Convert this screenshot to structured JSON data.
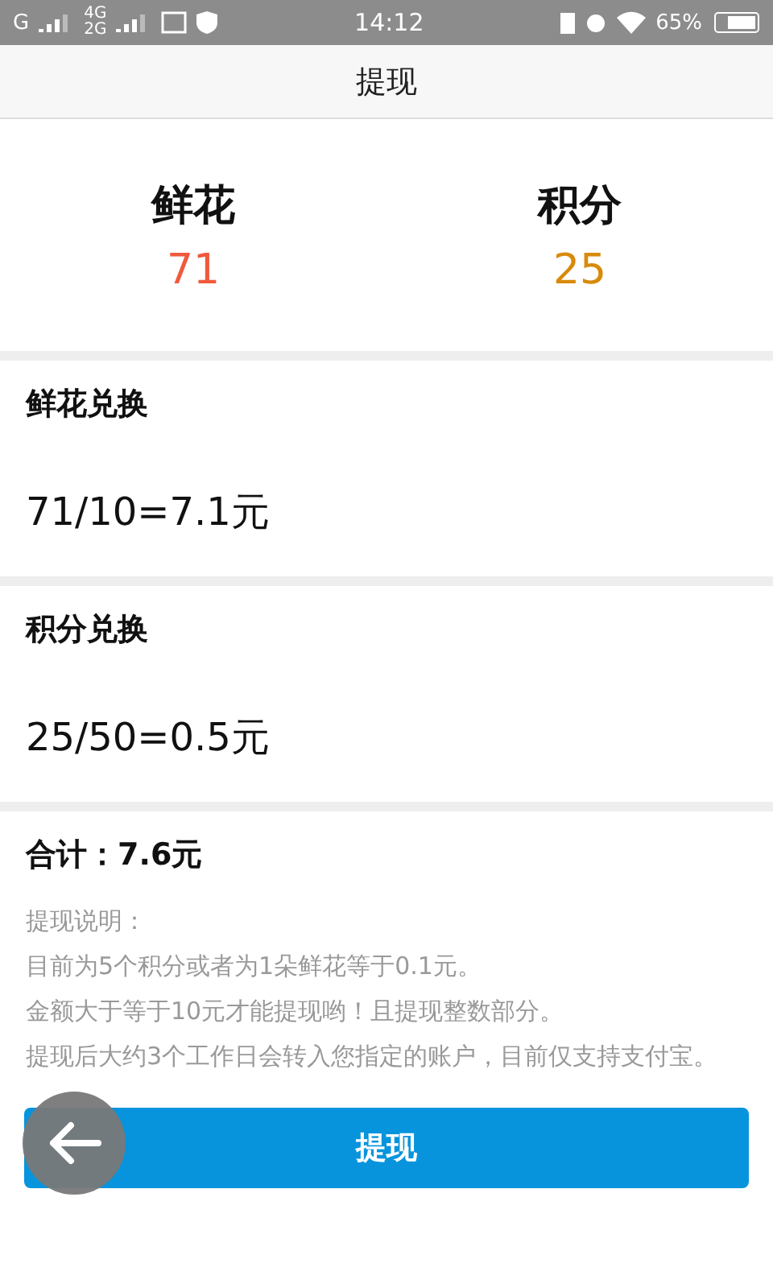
{
  "status_bar": {
    "network_1": "G",
    "network_2": "4G",
    "network_3": "2G",
    "time": "14:12",
    "battery": "65%"
  },
  "header": {
    "title": "提现"
  },
  "balances": [
    {
      "label": "鲜花",
      "value": "71",
      "color": "#f05a3c"
    },
    {
      "label": "积分",
      "value": "25",
      "color": "#d88a0a"
    }
  ],
  "exchanges": [
    {
      "title": "鲜花兑换",
      "formula": "71/10=7.1元"
    },
    {
      "title": "积分兑换",
      "formula": "25/50=0.5元"
    }
  ],
  "total": "合计：7.6元",
  "notes": [
    "提现说明：",
    "目前为5个积分或者为1朵鲜花等于0.1元。",
    "金额大于等于10元才能提现哟！且提现整数部分。",
    "提现后大约3个工作日会转入您指定的账户，目前仅支持支付宝。"
  ],
  "submit_button": "提现"
}
